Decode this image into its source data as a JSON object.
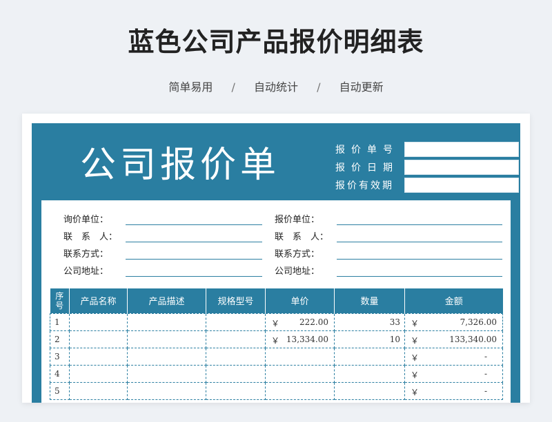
{
  "header": {
    "title": "蓝色公司产品报价明细表",
    "features": [
      "简单易用",
      "自动统计",
      "自动更新"
    ],
    "separator": "/"
  },
  "document": {
    "title": "公司报价单",
    "meta_fields": [
      {
        "label": "报价单号",
        "value": ""
      },
      {
        "label": "报价日期",
        "value": ""
      },
      {
        "label": "报价有效期",
        "value": ""
      }
    ],
    "left_info": [
      {
        "label": "询价单位：",
        "value": ""
      },
      {
        "label": "联　系　人：",
        "value": ""
      },
      {
        "label": "联系方式：",
        "value": ""
      },
      {
        "label": "公司地址：",
        "value": ""
      }
    ],
    "right_info": [
      {
        "label": "报价单位：",
        "value": ""
      },
      {
        "label": "联　系　人：",
        "value": ""
      },
      {
        "label": "联系方式：",
        "value": ""
      },
      {
        "label": "公司地址：",
        "value": ""
      }
    ]
  },
  "table": {
    "columns": [
      "序号",
      "产品名称",
      "产品描述",
      "规格型号",
      "单价",
      "数量",
      "金额"
    ],
    "currency": "￥",
    "rows": [
      {
        "no": "1",
        "name": "",
        "desc": "",
        "spec": "",
        "price": "222.00",
        "qty": "33",
        "amount": "7,326.00"
      },
      {
        "no": "2",
        "name": "",
        "desc": "",
        "spec": "",
        "price": "13,334.00",
        "qty": "10",
        "amount": "133,340.00"
      },
      {
        "no": "3",
        "name": "",
        "desc": "",
        "spec": "",
        "price": "",
        "qty": "",
        "amount": "-"
      },
      {
        "no": "4",
        "name": "",
        "desc": "",
        "spec": "",
        "price": "",
        "qty": "",
        "amount": "-"
      },
      {
        "no": "5",
        "name": "",
        "desc": "",
        "spec": "",
        "price": "",
        "qty": "",
        "amount": "-"
      }
    ]
  },
  "colors": {
    "accent": "#2a7ea1",
    "background": "#eef1f5"
  }
}
